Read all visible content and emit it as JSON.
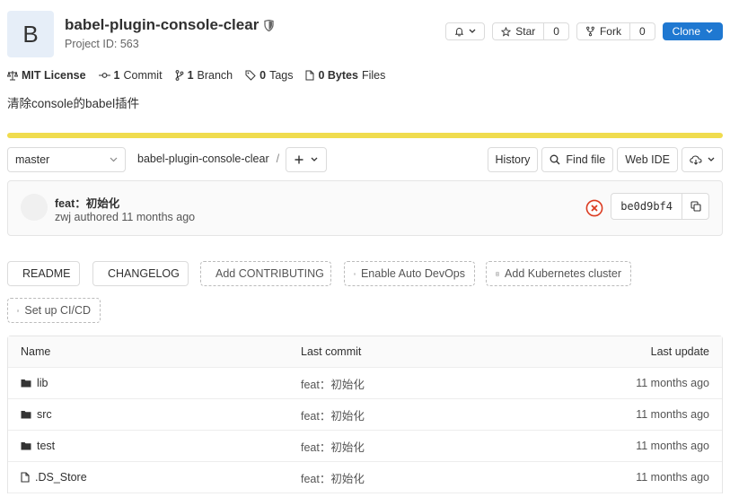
{
  "project": {
    "avatar_letter": "B",
    "name": "babel-plugin-console-clear",
    "id_text": "Project ID: 563",
    "description": "清除console的babel插件"
  },
  "actions": {
    "star_label": "Star",
    "star_count": "0",
    "fork_label": "Fork",
    "fork_count": "0",
    "clone_label": "Clone"
  },
  "stats": [
    {
      "icon": "scale-icon",
      "value": "MIT License",
      "label": ""
    },
    {
      "icon": "commit-icon",
      "value": "1",
      "label": "Commit"
    },
    {
      "icon": "branch-icon",
      "value": "1",
      "label": "Branch"
    },
    {
      "icon": "tag-icon",
      "value": "0",
      "label": "Tags"
    },
    {
      "icon": "file-icon",
      "value": "0 Bytes",
      "label": "Files"
    }
  ],
  "language_bar_color": "#f0dc4e",
  "repo_nav": {
    "branch": "master",
    "path": "babel-plugin-console-clear",
    "separator": "/",
    "history": "History",
    "find_file": "Find file",
    "web_ide": "Web IDE"
  },
  "last_commit": {
    "title": "feat：初始化",
    "author": "zwj",
    "meta": "authored 11 months ago",
    "sha": "be0d9bf4",
    "status": "failed"
  },
  "shortcuts": {
    "readme": "README",
    "changelog": "CHANGELOG",
    "contributing": "Add CONTRIBUTING",
    "devops": "Enable Auto DevOps",
    "kubernetes": "Add Kubernetes cluster",
    "cicd": "Set up CI/CD"
  },
  "table": {
    "headers": {
      "name": "Name",
      "commit": "Last commit",
      "update": "Last update"
    },
    "rows": [
      {
        "type": "folder",
        "name": "lib",
        "commit": "feat：初始化",
        "update": "11 months ago"
      },
      {
        "type": "folder",
        "name": "src",
        "commit": "feat：初始化",
        "update": "11 months ago"
      },
      {
        "type": "folder",
        "name": "test",
        "commit": "feat：初始化",
        "update": "11 months ago"
      },
      {
        "type": "file",
        "name": ".DS_Store",
        "commit": "feat：初始化",
        "update": "11 months ago"
      }
    ]
  },
  "colors": {
    "accent": "#1f78d1",
    "danger": "#db3b21"
  }
}
